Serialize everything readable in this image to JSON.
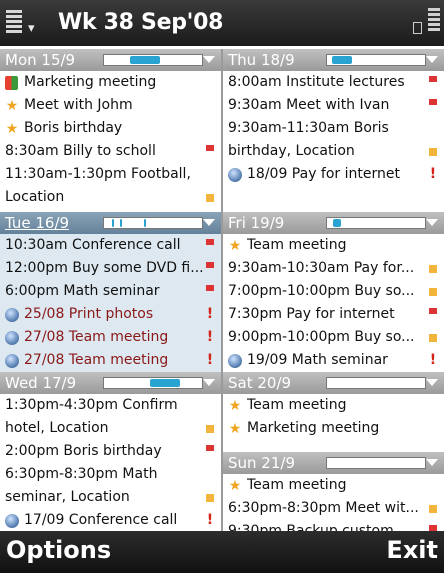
{
  "header": {
    "title": "Wk 38 Sep'08"
  },
  "softkeys": {
    "left": "Options",
    "right": "Exit"
  },
  "days": {
    "mon": {
      "label": "Mon 15/9",
      "events": [
        {
          "text": "Marketing meeting",
          "icon": "book-icon"
        },
        {
          "text": "Meet with Johm",
          "icon": "star-icon"
        },
        {
          "text": "Boris birthday",
          "icon": "star-icon"
        },
        {
          "text": "8:30am Billy to scholl",
          "marker": "flag"
        },
        {
          "text": "11:30am-1:30pm Football,",
          "marker": ""
        },
        {
          "text": "Location",
          "marker": "square"
        }
      ]
    },
    "tue": {
      "label": "Tue 16/9",
      "events": [
        {
          "text": "10:30am Conference call",
          "marker": "flag"
        },
        {
          "text": "12:00pm Buy some DVD fi...",
          "marker": "flag"
        },
        {
          "text": "6:00pm Math seminar",
          "marker": "flag"
        },
        {
          "text": "25/08 Print photos",
          "icon": "todo-icon",
          "marker": "!"
        },
        {
          "text": "27/08 Team meeting",
          "icon": "todo-icon",
          "marker": "!"
        },
        {
          "text": "27/08 Team meeting",
          "icon": "todo-icon",
          "marker": "!"
        }
      ]
    },
    "wed": {
      "label": "Wed 17/9",
      "events": [
        {
          "text": "1:30pm-4:30pm Confirm",
          "marker": ""
        },
        {
          "text": "hotel, Location",
          "marker": "square"
        },
        {
          "text": "2:00pm Boris birthday",
          "marker": "flag"
        },
        {
          "text": "6:30pm-8:30pm Math",
          "marker": ""
        },
        {
          "text": "seminar, Location",
          "marker": "square"
        },
        {
          "text": "17/09 Conference call",
          "icon": "todo-icon",
          "marker": "!"
        }
      ]
    },
    "thu": {
      "label": "Thu 18/9",
      "events": [
        {
          "text": "8:00am Institute lectures",
          "marker": "flag"
        },
        {
          "text": "9:30am Meet with Ivan",
          "marker": "flag"
        },
        {
          "text": "9:30am-11:30am Boris",
          "marker": ""
        },
        {
          "text": "birthday, Location",
          "marker": "square"
        },
        {
          "text": "18/09 Pay for internet",
          "icon": "todo-icon",
          "marker": "!"
        }
      ]
    },
    "fri": {
      "label": "Fri 19/9",
      "events": [
        {
          "text": "Team meeting",
          "icon": "star-icon"
        },
        {
          "text": "9:30am-10:30am Pay for...",
          "marker": "square"
        },
        {
          "text": "7:00pm-10:00pm Buy so...",
          "marker": "square"
        },
        {
          "text": "7:30pm Pay for internet",
          "marker": "flag"
        },
        {
          "text": "9:00pm-10:00pm Buy so...",
          "marker": "square"
        },
        {
          "text": "19/09 Math seminar",
          "icon": "todo-icon",
          "marker": "!"
        }
      ]
    },
    "sat": {
      "label": "Sat 20/9",
      "events": [
        {
          "text": "Team meeting",
          "icon": "star-icon"
        },
        {
          "text": "Marketing meeting",
          "icon": "star-icon"
        }
      ]
    },
    "sun": {
      "label": "Sun 21/9",
      "events": [
        {
          "text": "Team meeting",
          "icon": "star-icon"
        },
        {
          "text": "6:30pm-8:30pm Meet wit...",
          "marker": "square"
        },
        {
          "text": "9:30pm Backup custom...",
          "marker": "flag"
        }
      ]
    }
  }
}
